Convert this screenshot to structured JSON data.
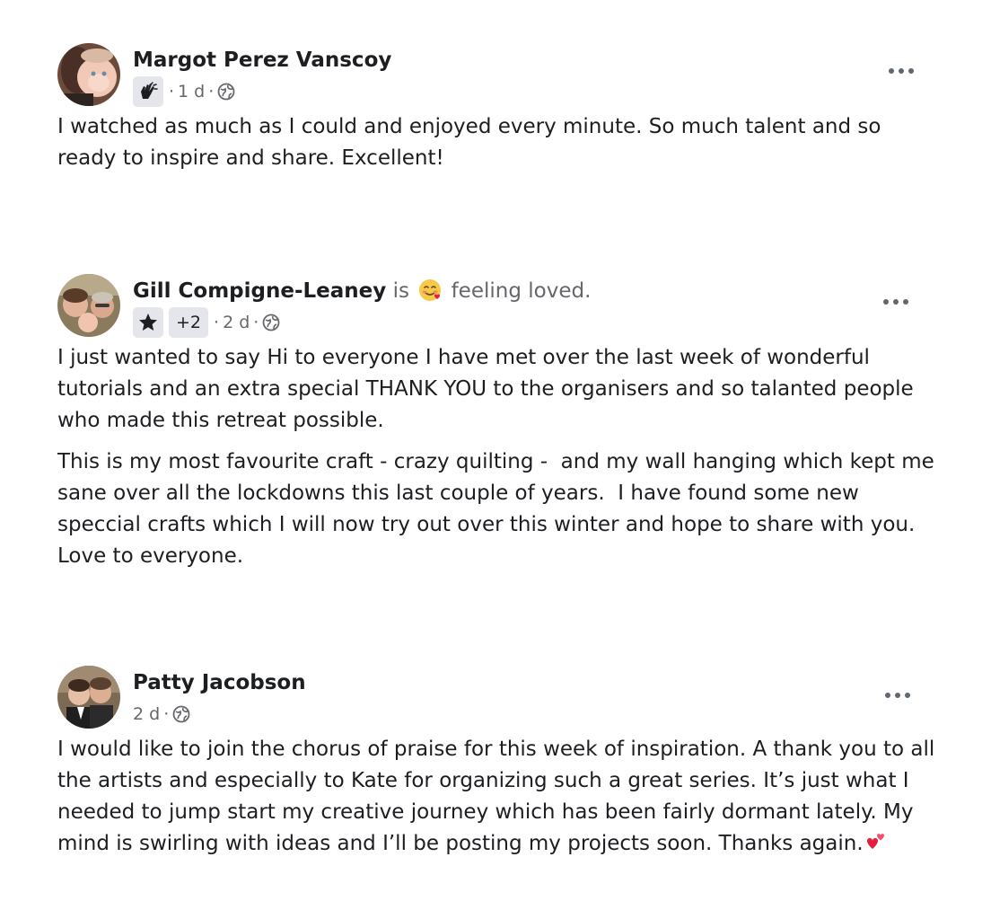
{
  "posts": [
    {
      "author": "Margot Perez Vanscoy",
      "feeling": null,
      "badges": [
        {
          "icon": "clapping-hands-icon"
        }
      ],
      "extra_badge": null,
      "time": "1 d",
      "visibility_icon": "globe-icon",
      "paragraphs": [
        "I watched as much as I could and enjoyed every minute. So much talent and so ready to inspire and share. Excellent!"
      ]
    },
    {
      "author": "Gill Compigne-Leaney",
      "feeling": {
        "prefix": "is",
        "emoji": "smiling-face-with-hearts-emoji",
        "text": "feeling loved."
      },
      "badges": [
        {
          "icon": "star-icon"
        }
      ],
      "extra_badge": "+2",
      "time": "2 d",
      "visibility_icon": "globe-icon",
      "paragraphs": [
        "I just wanted to say Hi to everyone I have met over the last week of wonderful tutorials and an extra special THANK YOU to the organisers and so talanted people who made this retreat possible.",
        "This is my most favourite craft - crazy quilting -  and my wall hanging which kept me sane over all the lockdowns this last couple of years.  I have found some new speccial crafts which I will now try out over this winter and hope to share with you.  Love to everyone."
      ]
    },
    {
      "author": "Patty Jacobson",
      "feeling": null,
      "badges": [],
      "extra_badge": null,
      "time": "2 d",
      "visibility_icon": "globe-icon",
      "paragraphs": [
        "I would like to join the chorus of praise for this week of inspiration. A thank you to all the artists and especially to Kate for organizing such a great series. It’s just what I needed to jump start my creative journey which has been fairly dormant lately. My mind is swirling with ideas and I’ll be posting my projects soon. Thanks again."
      ],
      "trailing_icon": "two-hearts-icon"
    }
  ],
  "colors": {
    "text": "#1c1e21",
    "secondary": "#65676b",
    "badge_bg": "#e4e6eb",
    "heart": "#e41e3f"
  }
}
